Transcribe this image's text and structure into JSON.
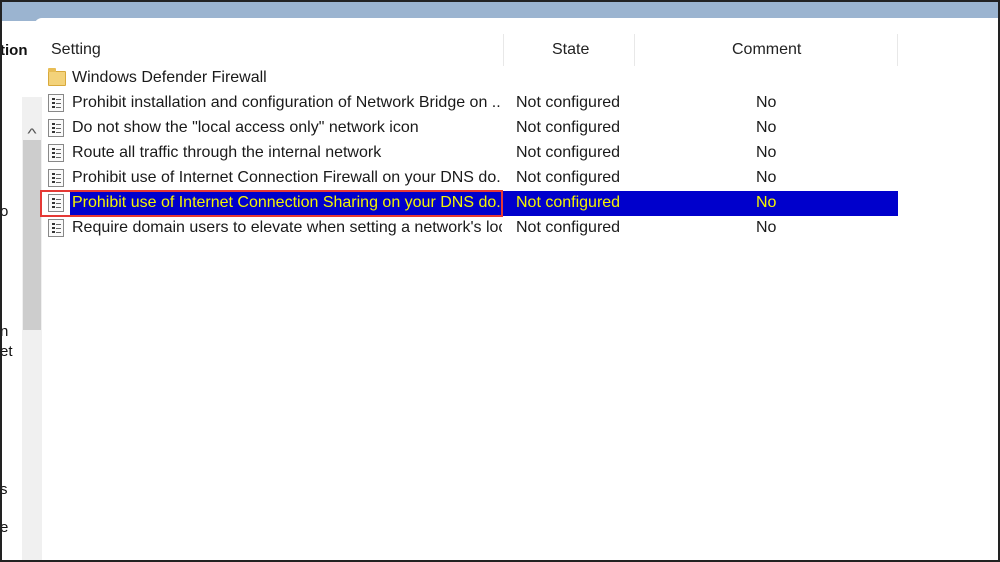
{
  "left_pane": {
    "header_fragment": "tion",
    "fragments": [
      "o",
      "n",
      "et",
      "s",
      "e"
    ]
  },
  "columns": {
    "setting": "Setting",
    "state": "State",
    "comment": "Comment"
  },
  "folder": {
    "name": "Windows Defender Firewall",
    "icon": "folder-icon"
  },
  "rows": [
    {
      "name": "Prohibit installation and configuration of Network Bridge on ...",
      "state": "Not configured",
      "comment": "No"
    },
    {
      "name": "Do not show the \"local access only\" network icon",
      "state": "Not configured",
      "comment": "No"
    },
    {
      "name": "Route all traffic through the internal network",
      "state": "Not configured",
      "comment": "No"
    },
    {
      "name": "Prohibit use of Internet Connection Firewall on your DNS do...",
      "state": "Not configured",
      "comment": "No"
    },
    {
      "name": "Prohibit use of Internet Connection Sharing on your DNS do...",
      "state": "Not configured",
      "comment": "No",
      "selected": true
    },
    {
      "name": "Require domain users to elevate when setting a network's loc...",
      "state": "Not configured",
      "comment": "No"
    }
  ],
  "colors": {
    "selection": "#0000cc",
    "selection_text": "#f4f400",
    "highlight_box": "#e53935",
    "title_band": "#9bb4d0"
  }
}
